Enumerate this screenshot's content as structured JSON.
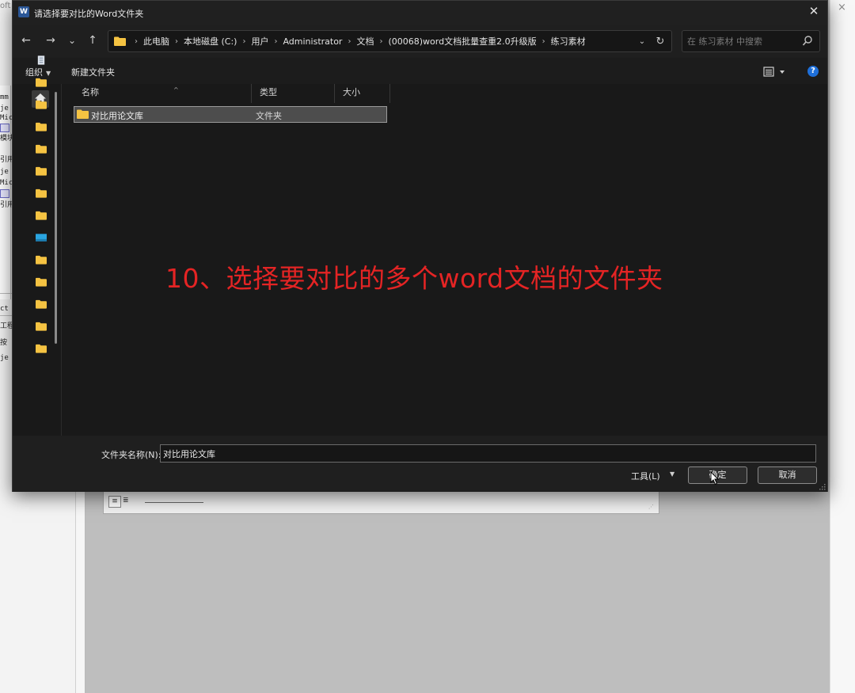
{
  "background": {
    "title_fragment": "oft",
    "close_glyph": "×",
    "left_tags": [
      "mm",
      "je",
      "Mic",
      "模块",
      "引用",
      "je",
      "Mic",
      "引用",
      "ct",
      "工程",
      "按",
      "je"
    ]
  },
  "dialog": {
    "title": "请选择要对比的Word文件夹",
    "app_icon_letter": "W",
    "close_glyph": "✕",
    "nav": {
      "back": "←",
      "forward": "→",
      "recent": "⌄",
      "up": "↑"
    },
    "breadcrumb": [
      "此电脑",
      "本地磁盘 (C:)",
      "用户",
      "Administrator",
      "文档",
      "(00068)word文档批量查重2.0升级版",
      "练习素材"
    ],
    "breadcrumb_separator": "›",
    "search": {
      "placeholder": "在 练习素材 中搜索"
    },
    "toolbar": {
      "organize": "组织",
      "organize_caret": "▼",
      "new_folder": "新建文件夹",
      "help": "?"
    },
    "columns": {
      "name": "名称",
      "type": "类型",
      "size": "大小"
    },
    "files": [
      {
        "name": "对比用论文库",
        "type": "文件夹"
      }
    ],
    "annotation": "10、选择要对比的多个word文档的文件夹",
    "bottom": {
      "filename_label": "文件夹名称(N):",
      "filename_value": "对比用论文库",
      "tools": "工具(L)",
      "tools_caret": "▼",
      "ok": "确定",
      "cancel": "取消"
    },
    "colors": {
      "background": "#191919",
      "annotation": "#e42424",
      "folder": "#f5c342",
      "help": "#1e6fd9"
    }
  }
}
